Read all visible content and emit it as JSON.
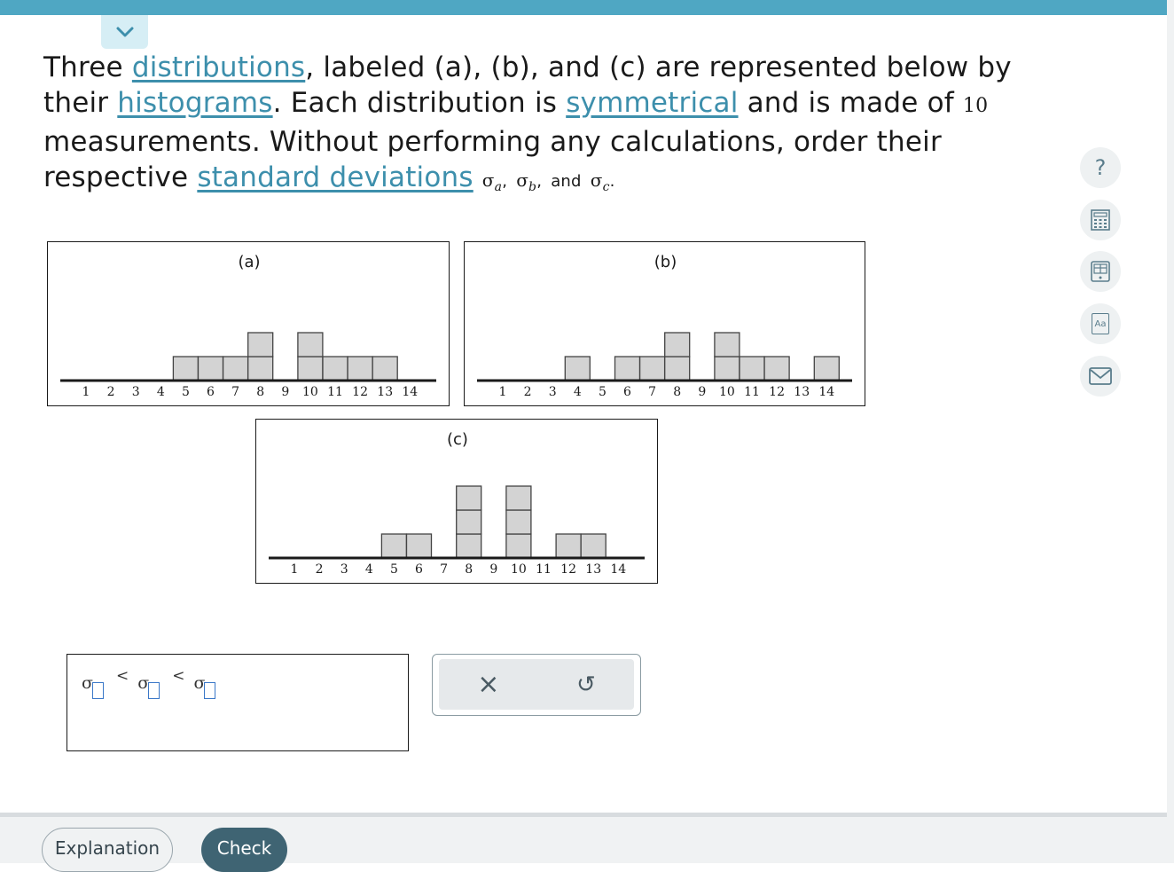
{
  "question": {
    "t1": "Three ",
    "link_distributions": "distributions",
    "t2": ", labeled (a), (b), and (c) are represented below by their ",
    "link_histograms": "histograms",
    "t3": ". Each distribution is ",
    "link_symmetrical": "symmetrical",
    "t4": " and is made of ",
    "count": "10",
    "t5": " measurements. Without performing any calculations, order their respective ",
    "link_std": "standard deviations",
    "sigma": "σ",
    "sub_a": "a",
    "sub_b": "b",
    "sub_c": "c",
    "and": "and",
    "comma": ",",
    "period": "."
  },
  "tools": [
    "help-icon",
    "calculator-icon",
    "data-table-icon",
    "glossary-icon",
    "mail-icon"
  ],
  "tools_text": {
    "help": "?",
    "glossary": "Aa"
  },
  "histograms": [
    {
      "label": "(a)",
      "ticks": [
        1,
        2,
        3,
        4,
        5,
        6,
        7,
        8,
        9,
        10,
        11,
        12,
        13,
        14
      ],
      "bins": [
        {
          "x": 5,
          "count": 1
        },
        {
          "x": 6,
          "count": 1
        },
        {
          "x": 7,
          "count": 1
        },
        {
          "x": 8,
          "count": 2
        },
        {
          "x": 10,
          "count": 2
        },
        {
          "x": 11,
          "count": 1
        },
        {
          "x": 12,
          "count": 1
        },
        {
          "x": 13,
          "count": 1
        }
      ]
    },
    {
      "label": "(b)",
      "ticks": [
        1,
        2,
        3,
        4,
        5,
        6,
        7,
        8,
        9,
        10,
        11,
        12,
        13,
        14
      ],
      "bins": [
        {
          "x": 4,
          "count": 1
        },
        {
          "x": 6,
          "count": 1
        },
        {
          "x": 7,
          "count": 1
        },
        {
          "x": 8,
          "count": 2
        },
        {
          "x": 10,
          "count": 2
        },
        {
          "x": 11,
          "count": 1
        },
        {
          "x": 12,
          "count": 1
        },
        {
          "x": 14,
          "count": 1
        }
      ]
    },
    {
      "label": "(c)",
      "ticks": [
        1,
        2,
        3,
        4,
        5,
        6,
        7,
        8,
        9,
        10,
        11,
        12,
        13,
        14
      ],
      "bins": [
        {
          "x": 5,
          "count": 1
        },
        {
          "x": 6,
          "count": 1
        },
        {
          "x": 8,
          "count": 3
        },
        {
          "x": 10,
          "count": 3
        },
        {
          "x": 12,
          "count": 1
        },
        {
          "x": 13,
          "count": 1
        }
      ]
    }
  ],
  "answer": {
    "sigma": "σ",
    "less_than": "<"
  },
  "actions": {
    "clear": "×",
    "undo": "↺"
  },
  "footer": {
    "explanation": "Explanation",
    "check": "Check"
  },
  "colors": {
    "accent": "#4fa7c3",
    "link": "#3d8fac",
    "bar_fill": "#d3d3d3",
    "check_bg": "#3f6473"
  }
}
